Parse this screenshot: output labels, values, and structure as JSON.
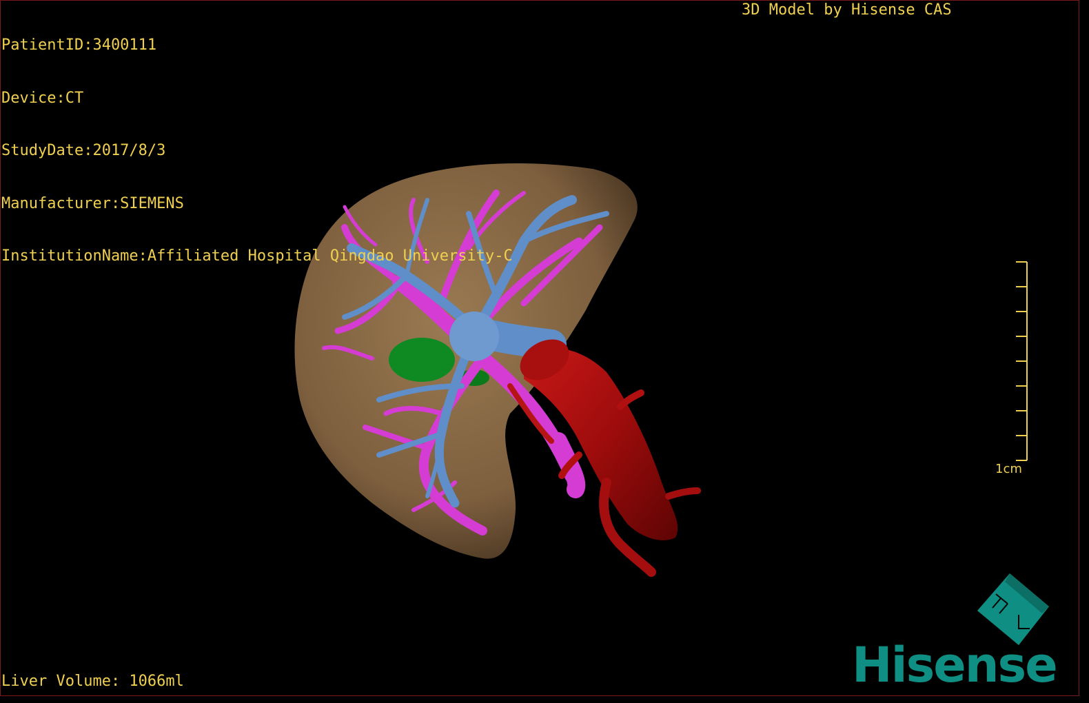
{
  "header": {
    "patient_id": "PatientID:3400111",
    "device": "Device:CT",
    "study_date": "StudyDate:2017/8/3",
    "manufacturer": "Manufacturer:SIEMENS",
    "institution": "InstitutionName:Affiliated Hospital Qingdao University-C"
  },
  "brand": {
    "model_credit": "3D Model by Hisense CAS",
    "logo_text": "Hisense",
    "logo_color": "#0f8f84"
  },
  "scale_bar": {
    "label": "1cm",
    "color": "#f0d050"
  },
  "footer": {
    "liver_volume": "Liver Volume: 1066ml"
  },
  "model": {
    "liver_color": "#8a6a45",
    "portal_vein_color": "#d43cd4",
    "hepatic_vein_color": "#5f8ec8",
    "vena_cava_color": "#b01010",
    "gallbladder_color": "#108a20"
  }
}
